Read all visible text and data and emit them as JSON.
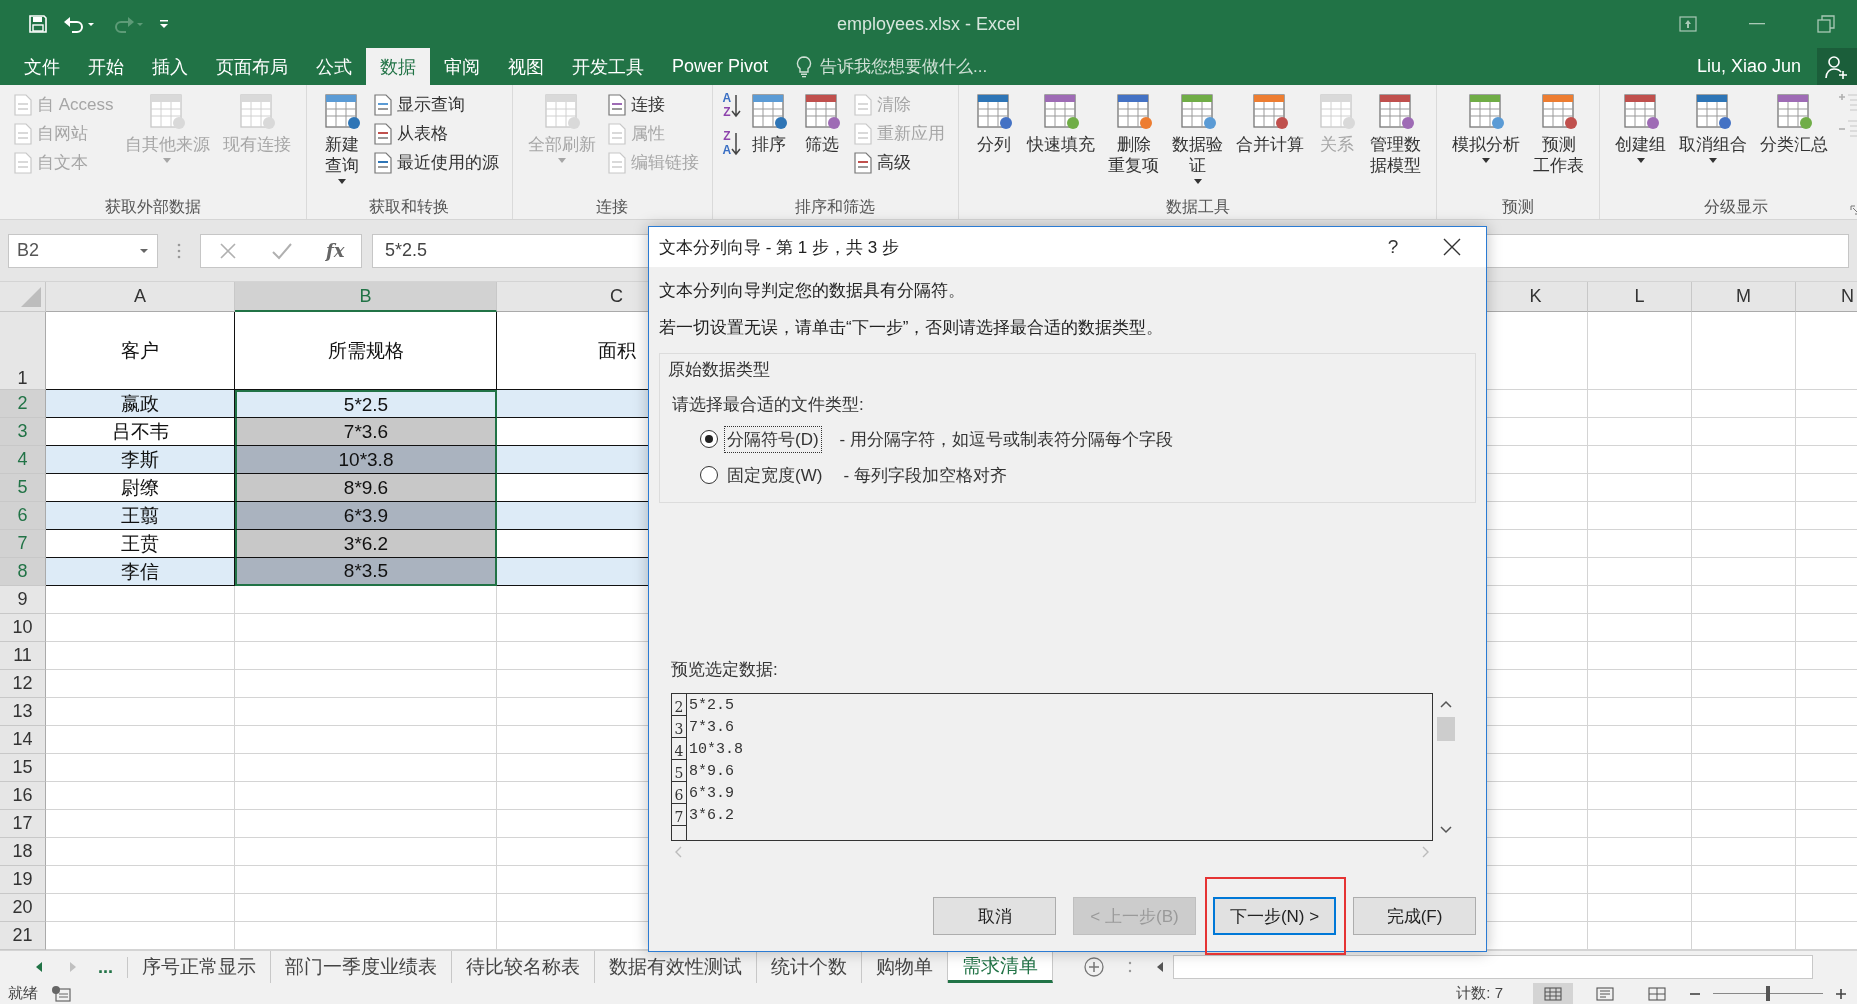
{
  "quick_access": [
    {
      "kind": "save",
      "disabled": false
    },
    {
      "kind": "undo",
      "disabled": false
    },
    {
      "kind": "redo",
      "disabled": true
    },
    {
      "kind": "customize",
      "disabled": false
    }
  ],
  "window": {
    "title": "employees.xlsx - Excel"
  },
  "ribbon_tabs": [
    {
      "label": "文件",
      "selected": false
    },
    {
      "label": "开始",
      "selected": false
    },
    {
      "label": "插入",
      "selected": false
    },
    {
      "label": "页面布局",
      "selected": false
    },
    {
      "label": "公式",
      "selected": false
    },
    {
      "label": "数据",
      "selected": true
    },
    {
      "label": "审阅",
      "selected": false
    },
    {
      "label": "视图",
      "selected": false
    },
    {
      "label": "开发工具",
      "selected": false
    },
    {
      "label": "Power Pivot",
      "selected": false
    }
  ],
  "tell_me": {
    "placeholder": "告诉我您想要做什么..."
  },
  "user": "Liu, Xiao Jun",
  "ribbon_groups": [
    {
      "title": "获取外部数据",
      "items": [
        {
          "kind": "small_stack",
          "entries": [
            {
              "label": "自 Access",
              "disabled": true
            },
            {
              "label": "自网站",
              "disabled": true
            },
            {
              "label": "自文本",
              "disabled": true
            }
          ]
        },
        {
          "kind": "large",
          "lines": [
            "自其他来源"
          ],
          "disabled": true,
          "dropdown": true
        },
        {
          "kind": "large",
          "lines": [
            "现有连接"
          ],
          "disabled": true,
          "dropdown": false
        }
      ]
    },
    {
      "title": "获取和转换",
      "items": [
        {
          "kind": "large",
          "lines": [
            "新建",
            "查询"
          ],
          "disabled": false,
          "dropdown": true
        },
        {
          "kind": "small_stack",
          "entries": [
            {
              "label": "显示查询",
              "disabled": false
            },
            {
              "label": "从表格",
              "disabled": false
            },
            {
              "label": "最近使用的源",
              "disabled": false
            }
          ]
        }
      ]
    },
    {
      "title": "连接",
      "items": [
        {
          "kind": "large",
          "lines": [
            "全部刷新"
          ],
          "disabled": true,
          "dropdown": true
        },
        {
          "kind": "small_stack",
          "entries": [
            {
              "label": "连接",
              "disabled": false
            },
            {
              "label": "属性",
              "disabled": true
            },
            {
              "label": "编辑链接",
              "disabled": true
            }
          ]
        }
      ]
    },
    {
      "title": "排序和筛选",
      "items": [
        {
          "kind": "sort_icons",
          "ascending": [
            "A",
            "Z"
          ],
          "descending": [
            "Z",
            "A"
          ]
        },
        {
          "kind": "large",
          "lines": [
            "排序"
          ],
          "disabled": false,
          "dropdown": false
        },
        {
          "kind": "large",
          "lines": [
            "筛选"
          ],
          "disabled": false,
          "dropdown": false
        },
        {
          "kind": "small_stack",
          "entries": [
            {
              "label": "清除",
              "disabled": true
            },
            {
              "label": "重新应用",
              "disabled": true
            },
            {
              "label": "高级",
              "disabled": false
            }
          ]
        }
      ]
    },
    {
      "title": "数据工具",
      "items": [
        {
          "kind": "large",
          "lines": [
            "分列"
          ],
          "disabled": false,
          "dropdown": false
        },
        {
          "kind": "large",
          "lines": [
            "快速填充"
          ],
          "disabled": false,
          "dropdown": false
        },
        {
          "kind": "large",
          "lines": [
            "删除",
            "重复项"
          ],
          "disabled": false,
          "dropdown": false
        },
        {
          "kind": "large",
          "lines": [
            "数据验",
            "证"
          ],
          "disabled": false,
          "dropdown": true
        },
        {
          "kind": "large",
          "lines": [
            "合并计算"
          ],
          "disabled": false,
          "dropdown": false
        },
        {
          "kind": "large",
          "lines": [
            "关系"
          ],
          "disabled": true,
          "dropdown": false
        },
        {
          "kind": "large",
          "lines": [
            "管理数",
            "据模型"
          ],
          "disabled": false,
          "dropdown": false
        }
      ]
    },
    {
      "title": "预测",
      "items": [
        {
          "kind": "large",
          "lines": [
            "模拟分析"
          ],
          "disabled": false,
          "dropdown": true
        },
        {
          "kind": "large",
          "lines": [
            "预测",
            "工作表"
          ],
          "disabled": false,
          "dropdown": false
        }
      ]
    },
    {
      "title": "分级显示",
      "launcher": true,
      "items": [
        {
          "kind": "large",
          "lines": [
            "创建组"
          ],
          "disabled": false,
          "dropdown": true
        },
        {
          "kind": "large",
          "lines": [
            "取消组合"
          ],
          "disabled": false,
          "dropdown": true
        },
        {
          "kind": "large",
          "lines": [
            "分类汇总"
          ],
          "disabled": false,
          "dropdown": false
        },
        {
          "kind": "detail_icons",
          "disabled": true
        }
      ]
    }
  ],
  "formula_bar": {
    "name_box": "B2",
    "fx": "fx",
    "formula": "5*2.5"
  },
  "columns_left": [
    {
      "label": "A",
      "selected": false
    },
    {
      "label": "B",
      "selected": true
    },
    {
      "label": "C",
      "selected": false
    }
  ],
  "columns_right": [
    {
      "label": "K"
    },
    {
      "label": "L"
    },
    {
      "label": "M"
    },
    {
      "label": "N"
    }
  ],
  "header_row": {
    "number": "1",
    "cells": [
      "客户",
      "所需规格",
      "面积"
    ]
  },
  "rows": [
    {
      "number": "2",
      "cells": [
        "嬴政",
        "5*2.5"
      ],
      "banded": true,
      "selected": true,
      "active": true
    },
    {
      "number": "3",
      "cells": [
        "吕不韦",
        "7*3.6"
      ],
      "banded": false,
      "selected": true,
      "active": false
    },
    {
      "number": "4",
      "cells": [
        "李斯",
        "10*3.8"
      ],
      "banded": true,
      "selected": true,
      "active": false
    },
    {
      "number": "5",
      "cells": [
        "尉缭",
        "8*9.6"
      ],
      "banded": false,
      "selected": true,
      "active": false
    },
    {
      "number": "6",
      "cells": [
        "王翦",
        "6*3.9"
      ],
      "banded": true,
      "selected": true,
      "active": false
    },
    {
      "number": "7",
      "cells": [
        "王贲",
        "3*6.2"
      ],
      "banded": false,
      "selected": true,
      "active": false
    },
    {
      "number": "8",
      "cells": [
        "李信",
        "8*3.5"
      ],
      "banded": true,
      "selected": true,
      "active": false
    }
  ],
  "empty_rows": [
    "9",
    "10",
    "11",
    "12",
    "13",
    "14",
    "15",
    "16",
    "17",
    "18",
    "19",
    "20",
    "21"
  ],
  "sheet_tabs": {
    "more": "...",
    "tabs": [
      {
        "label": "序号正常显示",
        "selected": false
      },
      {
        "label": "部门一季度业绩表",
        "selected": false
      },
      {
        "label": "待比较名称表",
        "selected": false
      },
      {
        "label": "数据有效性测试",
        "selected": false
      },
      {
        "label": "统计个数",
        "selected": false
      },
      {
        "label": "购物单",
        "selected": false
      },
      {
        "label": "需求清单",
        "selected": true
      }
    ]
  },
  "status": {
    "ready": "就绪",
    "count": "计数: 7",
    "views": [
      {
        "selected": true
      },
      {
        "selected": false
      },
      {
        "selected": false
      }
    ],
    "zoom": {
      "level": 0.5
    }
  },
  "dialog": {
    "title": "文本分列向导 - 第 1 步，共 3 步",
    "help": "?",
    "intro": "文本分列向导判定您的数据具有分隔符。",
    "instruction": "若一切设置无误，请单击“下一步”，否则请选择最合适的数据类型。",
    "group_title": "原始数据类型",
    "prompt": "请选择最合适的文件类型:",
    "options": [
      {
        "label": "分隔符号(D)",
        "description": "- 用分隔字符，如逗号或制表符分隔每个字段",
        "selected": true
      },
      {
        "label": "固定宽度(W)",
        "description": "- 每列字段加空格对齐",
        "selected": false
      }
    ],
    "preview_label": "预览选定数据:",
    "preview_rows": [
      {
        "number": "2",
        "text": "5*2.5"
      },
      {
        "number": "3",
        "text": "7*3.6"
      },
      {
        "number": "4",
        "text": "10*3.8"
      },
      {
        "number": "5",
        "text": "8*9.6"
      },
      {
        "number": "6",
        "text": "6*3.9"
      },
      {
        "number": "7",
        "text": "3*6.2"
      }
    ],
    "buttons": [
      {
        "label": "取消",
        "disabled": false,
        "default": false
      },
      {
        "label": "< 上一步(B)",
        "disabled": true,
        "default": false
      },
      {
        "label": "下一步(N) >",
        "disabled": false,
        "default": true
      },
      {
        "label": "完成(F)",
        "disabled": false,
        "default": false
      }
    ]
  }
}
